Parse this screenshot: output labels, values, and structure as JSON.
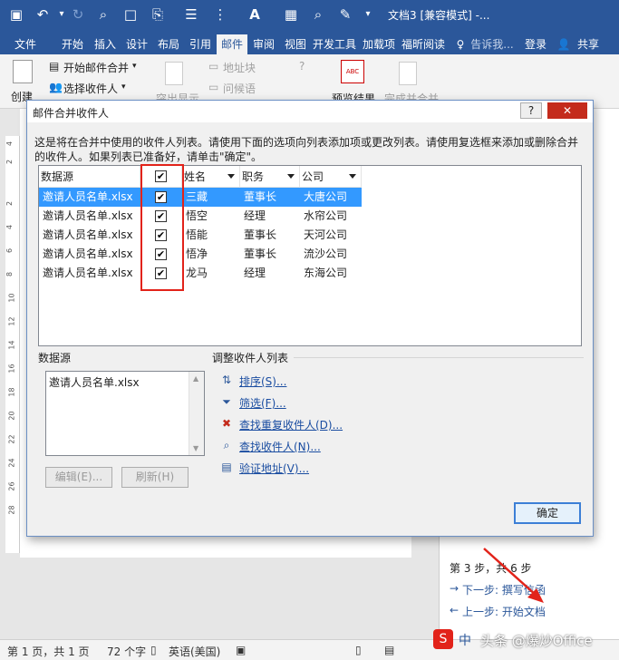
{
  "app": {
    "doc_title": "文档3 [兼容模式] -...",
    "quick_access": {
      "save": "save-icon",
      "undo": "undo-icon",
      "redo": "redo-icon"
    }
  },
  "tabs": [
    "文件",
    "开始",
    "插入",
    "设计",
    "布局",
    "引用",
    "邮件",
    "审阅",
    "视图",
    "开发工具",
    "加载项",
    "福昕阅读",
    "告诉我...",
    "登录",
    "共享"
  ],
  "active_tab": "邮件",
  "ribbon": {
    "create": "创建",
    "start_merge": "开始邮件合并",
    "select_recipients": "选择收件人",
    "address_block": "地址块",
    "greeting_line": "问候语",
    "highlight": "突出显示",
    "preview_results": "预览结果",
    "finish_merge": "完成并合并"
  },
  "ruler_numbers": [
    "4",
    "2",
    "2",
    "4",
    "6",
    "8",
    "10",
    "12",
    "14",
    "16",
    "18",
    "20",
    "22",
    "24",
    "26",
    "28"
  ],
  "dialog": {
    "title": "邮件合并收件人",
    "help_button": "?",
    "close_button": "✕",
    "description": "这是将在合并中使用的收件人列表。请使用下面的选项向列表添加项或更改列表。请使用复选框来添加或删除合并的收件人。如果列表已准备好，请单击\"确定\"。",
    "columns": {
      "source": "数据源",
      "name": "姓名",
      "position": "职务",
      "company": "公司"
    },
    "rows": [
      {
        "source": "邀请人员名单.xlsx",
        "checked": true,
        "name": "三藏",
        "position": "董事长",
        "company": "大唐公司"
      },
      {
        "source": "邀请人员名单.xlsx",
        "checked": true,
        "name": "悟空",
        "position": "经理",
        "company": "水帘公司"
      },
      {
        "source": "邀请人员名单.xlsx",
        "checked": true,
        "name": "悟能",
        "position": "董事长",
        "company": "天河公司"
      },
      {
        "source": "邀请人员名单.xlsx",
        "checked": true,
        "name": "悟净",
        "position": "董事长",
        "company": "流沙公司"
      },
      {
        "source": "邀请人员名单.xlsx",
        "checked": true,
        "name": "龙马",
        "position": "经理",
        "company": "东海公司"
      }
    ],
    "data_source_label": "数据源",
    "data_source_item": "邀请人员名单.xlsx",
    "edit_button": "编辑(E)...",
    "refresh_button": "刷新(H)",
    "adjust_label": "调整收件人列表",
    "links": {
      "sort": "排序(S)...",
      "filter": "筛选(F)...",
      "find_duplicates": "查找重复收件人(D)...",
      "find_recipient": "查找收件人(N)...",
      "validate": "验证地址(V)..."
    },
    "ok_button": "确定"
  },
  "pane": {
    "step": "第 3 步，共 6 步",
    "next": "下一步: 撰写信函",
    "prev": "上一步: 开始文档"
  },
  "status": {
    "page": "第 1 页，共 1 页",
    "words": "72 个字",
    "lang": "英语(美国)"
  },
  "watermark": {
    "prefix": "中",
    "text": "头条 @爆炒Office"
  },
  "colors": {
    "word_blue": "#2b579a",
    "selection": "#3399ff",
    "highlight_red": "#e2231a"
  }
}
